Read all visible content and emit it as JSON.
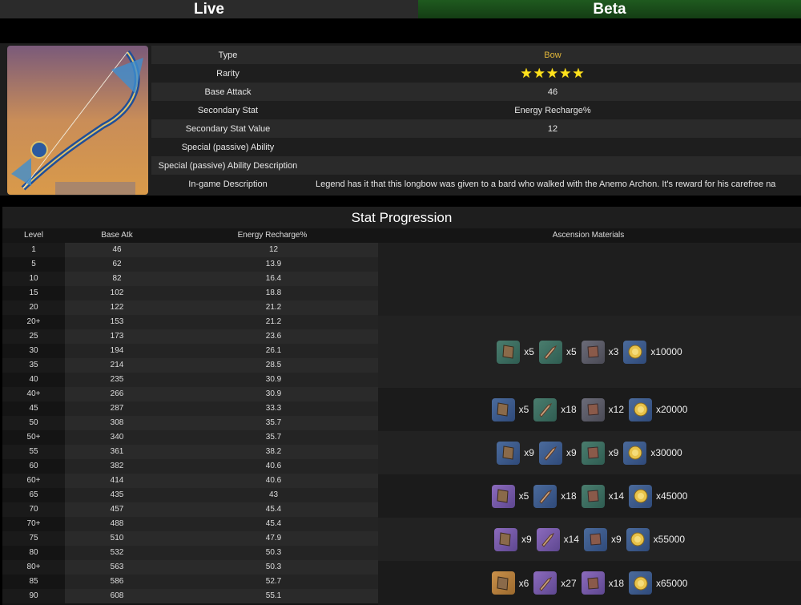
{
  "tabs": {
    "live": "Live",
    "beta": "Beta"
  },
  "info": {
    "rows": [
      {
        "label": "Type",
        "value": "Bow"
      },
      {
        "label": "Rarity",
        "value": "★★★★★"
      },
      {
        "label": "Base Attack",
        "value": "46"
      },
      {
        "label": "Secondary Stat",
        "value": "Energy Recharge%"
      },
      {
        "label": "Secondary Stat Value",
        "value": "12"
      },
      {
        "label": "Special (passive) Ability",
        "value": ""
      },
      {
        "label": "Special (passive) Ability Description",
        "value": ""
      },
      {
        "label": "In-game Description",
        "value": "Legend has it that this longbow was given to a bard who walked with the Anemo Archon. It's reward for his carefree na"
      }
    ]
  },
  "stats": {
    "title": "Stat Progression",
    "headers": {
      "level": "Level",
      "atk": "Base Atk",
      "er": "Energy Recharge%",
      "materials": "Ascension Materials"
    },
    "rows": [
      [
        "1",
        "46",
        "12"
      ],
      [
        "5",
        "62",
        "13.9"
      ],
      [
        "10",
        "82",
        "16.4"
      ],
      [
        "15",
        "102",
        "18.8"
      ],
      [
        "20",
        "122",
        "21.2"
      ],
      [
        "20+",
        "153",
        "21.2"
      ],
      [
        "25",
        "173",
        "23.6"
      ],
      [
        "30",
        "194",
        "26.1"
      ],
      [
        "35",
        "214",
        "28.5"
      ],
      [
        "40",
        "235",
        "30.9"
      ],
      [
        "40+",
        "266",
        "30.9"
      ],
      [
        "45",
        "287",
        "33.3"
      ],
      [
        "50",
        "308",
        "35.7"
      ],
      [
        "50+",
        "340",
        "35.7"
      ],
      [
        "55",
        "361",
        "38.2"
      ],
      [
        "60",
        "382",
        "40.6"
      ],
      [
        "60+",
        "414",
        "40.6"
      ],
      [
        "65",
        "435",
        "43"
      ],
      [
        "70",
        "457",
        "45.4"
      ],
      [
        "70+",
        "488",
        "45.4"
      ],
      [
        "75",
        "510",
        "47.9"
      ],
      [
        "80",
        "532",
        "50.3"
      ],
      [
        "80+",
        "563",
        "50.3"
      ],
      [
        "85",
        "586",
        "52.7"
      ],
      [
        "90",
        "608",
        "55.1"
      ]
    ],
    "materials": [
      {
        "items": [
          [
            "q-green",
            "x5"
          ],
          [
            "q-green",
            "x5"
          ],
          [
            "q-grey",
            "x3"
          ],
          [
            "q-blue",
            "x10000"
          ]
        ]
      },
      {
        "items": [
          [
            "q-blue",
            "x5"
          ],
          [
            "q-green",
            "x18"
          ],
          [
            "q-grey",
            "x12"
          ],
          [
            "q-blue",
            "x20000"
          ]
        ]
      },
      {
        "items": [
          [
            "q-blue",
            "x9"
          ],
          [
            "q-blue",
            "x9"
          ],
          [
            "q-green",
            "x9"
          ],
          [
            "q-blue",
            "x30000"
          ]
        ]
      },
      {
        "items": [
          [
            "q-purple",
            "x5"
          ],
          [
            "q-blue",
            "x18"
          ],
          [
            "q-green",
            "x14"
          ],
          [
            "q-blue",
            "x45000"
          ]
        ]
      },
      {
        "items": [
          [
            "q-purple",
            "x9"
          ],
          [
            "q-purple",
            "x14"
          ],
          [
            "q-blue",
            "x9"
          ],
          [
            "q-blue",
            "x55000"
          ]
        ]
      },
      {
        "items": [
          [
            "q-gold",
            "x6"
          ],
          [
            "q-purple",
            "x27"
          ],
          [
            "q-purple",
            "x18"
          ],
          [
            "q-blue",
            "x65000"
          ]
        ]
      }
    ]
  }
}
